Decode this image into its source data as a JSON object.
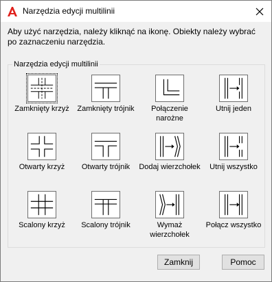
{
  "window": {
    "title": "Narzędzia edycji multilinii"
  },
  "instructions": "Aby użyć narzędzia, należy kliknąć na ikonę. Obiekty należy wybrać po zaznaczeniu narzędzia.",
  "group": {
    "label": "Narzędzia edycji multilinii"
  },
  "tools": [
    {
      "label": "Zamknięty krzyż",
      "icon": "closed-cross-icon"
    },
    {
      "label": "Zamknięty trójnik",
      "icon": "closed-tee-icon"
    },
    {
      "label": "Połączenie narożne",
      "icon": "corner-joint-icon"
    },
    {
      "label": "Utnij jeden",
      "icon": "cut-single-icon"
    },
    {
      "label": "Otwarty krzyż",
      "icon": "open-cross-icon"
    },
    {
      "label": "Otwarty trójnik",
      "icon": "open-tee-icon"
    },
    {
      "label": "Dodaj wierzchołek",
      "icon": "add-vertex-icon"
    },
    {
      "label": "Utnij wszystko",
      "icon": "cut-all-icon"
    },
    {
      "label": "Scalony krzyż",
      "icon": "merged-cross-icon"
    },
    {
      "label": "Scalony trójnik",
      "icon": "merged-tee-icon"
    },
    {
      "label": "Wymaż wierzchołek",
      "icon": "delete-vertex-icon"
    },
    {
      "label": "Połącz wszystko",
      "icon": "weld-all-icon"
    }
  ],
  "buttons": {
    "close_label": "Zamknij",
    "help_label": "Pomoc"
  },
  "colors": {
    "app_icon": "#e0201b",
    "background": "#f0f0f0"
  }
}
